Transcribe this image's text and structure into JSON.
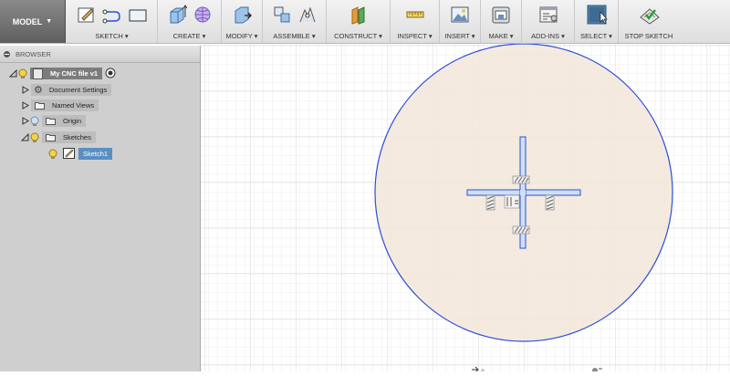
{
  "workspace": {
    "label": "MODEL"
  },
  "toolbar": {
    "groups": [
      {
        "label": "SKETCH ▾"
      },
      {
        "label": "CREATE ▾"
      },
      {
        "label": "MODIFY ▾"
      },
      {
        "label": "ASSEMBLE ▾"
      },
      {
        "label": "CONSTRUCT ▾"
      },
      {
        "label": "INSPECT ▾"
      },
      {
        "label": "INSERT ▾"
      },
      {
        "label": "MAKE ▾"
      },
      {
        "label": "ADD-INS ▾"
      },
      {
        "label": "SELECT ▾"
      },
      {
        "label": "STOP SKETCH"
      }
    ]
  },
  "browser": {
    "title": "BROWSER",
    "root": {
      "label": "My CNC file v1"
    },
    "items": [
      {
        "label": "Document Settings"
      },
      {
        "label": "Named Views"
      },
      {
        "label": "Origin"
      },
      {
        "label": "Sketches"
      },
      {
        "label": "Sketch1"
      }
    ]
  },
  "colors": {
    "circle_stroke": "#2b4fd8",
    "circle_fill": "#f3e6da",
    "axis_fill": "#cfe0f5",
    "axis_stroke": "#2b4fd8",
    "selection": "#5a8fc0"
  }
}
